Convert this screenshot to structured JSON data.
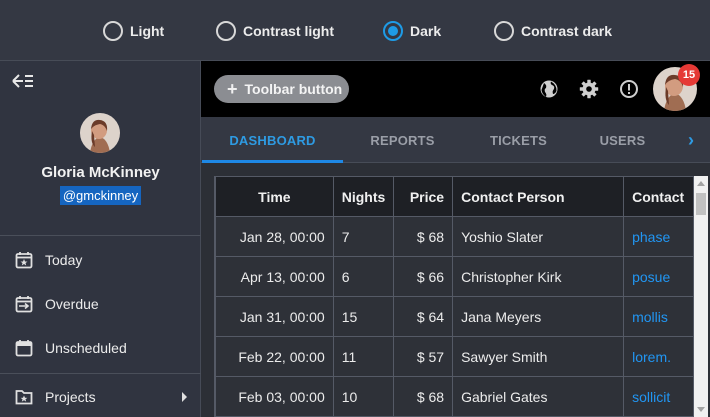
{
  "theme_options": [
    {
      "label": "Light",
      "checked": false
    },
    {
      "label": "Contrast light",
      "checked": false
    },
    {
      "label": "Dark",
      "checked": true
    },
    {
      "label": "Contrast dark",
      "checked": false
    }
  ],
  "drawer": {
    "back_icon": "arrow-collapse-left-icon",
    "user": {
      "name": "Gloria McKinney",
      "handle": "@gmckinney"
    },
    "nav": [
      {
        "label": "Today",
        "icon": "calendar-today-icon"
      },
      {
        "label": "Overdue",
        "icon": "calendar-overdue-icon"
      },
      {
        "label": "Unscheduled",
        "icon": "calendar-blank-icon"
      },
      {
        "label": "Projects",
        "icon": "folder-star-icon",
        "has_submenu": true
      }
    ]
  },
  "toolbar": {
    "button_label": "Toolbar button",
    "icons": [
      "globe-icon",
      "gear-icon",
      "alert-circle-icon"
    ],
    "badge_count": "15"
  },
  "tabs": [
    {
      "label": "DASHBOARD",
      "active": true
    },
    {
      "label": "REPORTS",
      "active": false
    },
    {
      "label": "TICKETS",
      "active": false
    },
    {
      "label": "USERS",
      "active": false
    }
  ],
  "grid": {
    "columns": [
      "Time",
      "Nights",
      "Price",
      "Contact Person",
      "Contact"
    ],
    "rows": [
      {
        "time": "Jan 28, 00:00",
        "nights": "7",
        "price": "$ 68",
        "person": "Yoshio Slater",
        "contact": "phase"
      },
      {
        "time": "Apr 13, 00:00",
        "nights": "6",
        "price": "$ 66",
        "person": "Christopher Kirk",
        "contact": "posue"
      },
      {
        "time": "Jan 31, 00:00",
        "nights": "15",
        "price": "$ 64",
        "person": "Jana Meyers",
        "contact": "mollis"
      },
      {
        "time": "Feb 22, 00:00",
        "nights": "11",
        "price": "$ 57",
        "person": "Sawyer Smith",
        "contact": "lorem."
      },
      {
        "time": "Feb 03, 00:00",
        "nights": "10",
        "price": "$ 68",
        "person": "Gabriel Gates",
        "contact": "sollicit"
      }
    ]
  },
  "colors": {
    "accent": "#1e88e5",
    "badge": "#e53935",
    "link": "#2196f3",
    "toolbar_bg": "#000000",
    "selection": "#1565c0"
  }
}
